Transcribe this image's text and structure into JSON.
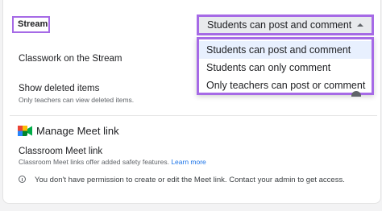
{
  "stream": {
    "label": "Stream",
    "select": {
      "value": "Students can post and comment",
      "options": [
        "Students can post and comment",
        "Students can only comment",
        "Only teachers can post or comment"
      ]
    }
  },
  "classwork": {
    "label": "Classwork on the Stream"
  },
  "deleted": {
    "label": "Show deleted items",
    "sub": "Only teachers can view deleted items."
  },
  "meet": {
    "title": "Manage Meet link",
    "link_label": "Classroom Meet link",
    "link_sub": "Classroom Meet links offer added safety features.",
    "learn_more": "Learn more",
    "info": "You don't have permission to create or edit the Meet link. Contact your admin to get access."
  },
  "colors": {
    "highlight": "#a66ae6",
    "link": "#1a73e8",
    "selected_option_bg": "#e8f0fe"
  }
}
